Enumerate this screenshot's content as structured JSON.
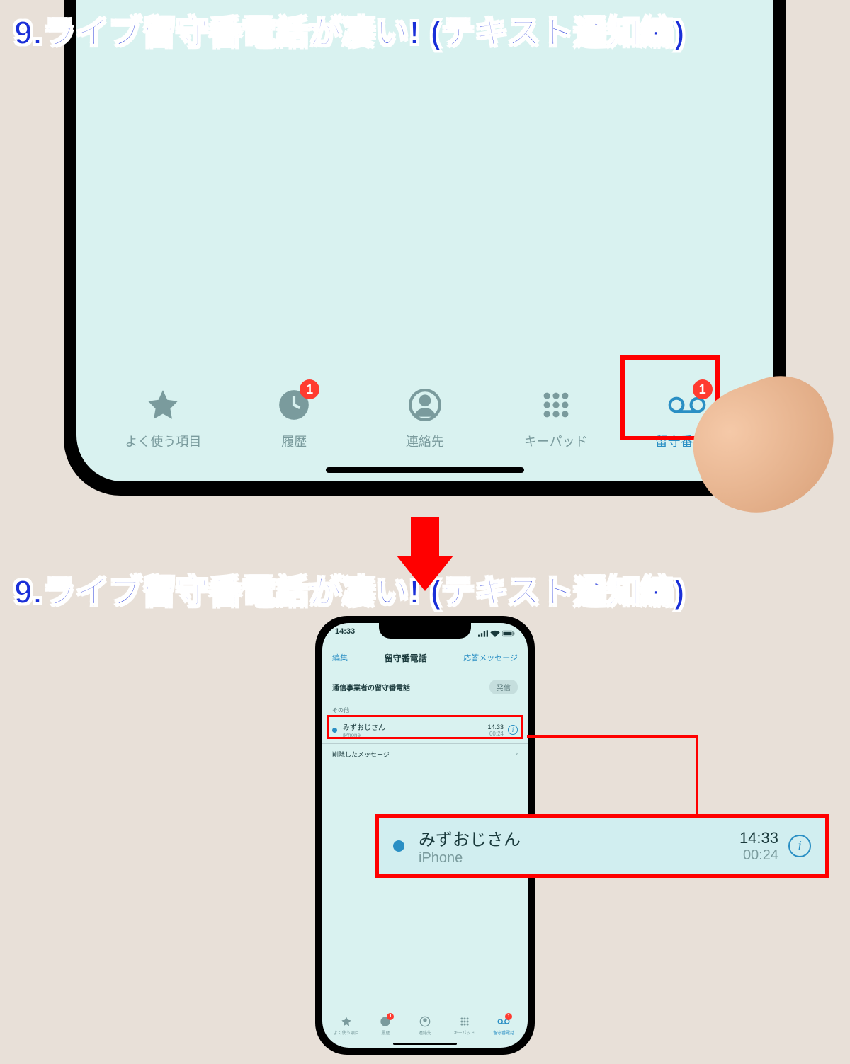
{
  "title": "9.ライブ留守番電話が凄い! (テキスト通知編)",
  "tabs": {
    "favorites": "よく使う項目",
    "recents": "履歴",
    "contacts": "連絡先",
    "keypad": "キーパッド",
    "voicemail": "留守番電話",
    "badge_recents": "1",
    "badge_voicemail": "1"
  },
  "voicemail_screen": {
    "status_time": "14:33",
    "nav_edit": "編集",
    "nav_title": "留守番電話",
    "nav_greeting": "応答メッセージ",
    "carrier_label": "通信事業者の留守番電話",
    "call_button": "発信",
    "section_other": "その他",
    "entry": {
      "name": "みずおじさん",
      "device": "iPhone",
      "time": "14:33",
      "duration": "00:24"
    },
    "deleted": "削除したメッセージ"
  }
}
